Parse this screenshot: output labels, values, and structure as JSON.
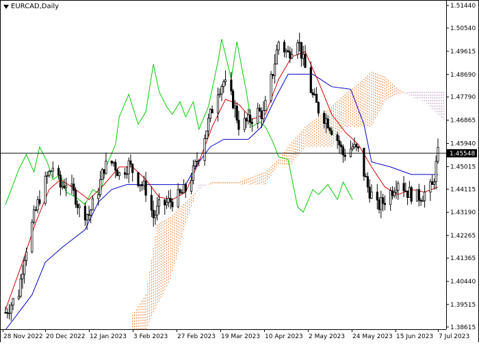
{
  "header": {
    "symbol_label": "EURCAD,Daily"
  },
  "colors": {
    "candle": "#000000",
    "tenkan": "#d40000",
    "kijun": "#0000c8",
    "chikou": "#00cc00",
    "cloud_up": "#f08030",
    "cloud_down": "#c8a0c8",
    "price_line": "#000000",
    "price_box_bg": "#000000",
    "price_box_text": "#ffffff"
  },
  "chart_data": {
    "type": "candlestick",
    "title": "EURCAD,Daily",
    "indicator": "Ichimoku Kinko Hyo",
    "y_axis_ticks": [
      "1.51440",
      "1.50540",
      "1.49615",
      "1.48690",
      "1.47790",
      "1.46865",
      "1.45940",
      "1.45015",
      "1.44115",
      "1.43190",
      "1.42265",
      "1.41365",
      "1.40440",
      "1.39515",
      "1.38615"
    ],
    "ylim": [
      1.3861,
      1.5155
    ],
    "x_axis_ticks": [
      "28 Nov 2022",
      "20 Dec 2022",
      "12 Jan 2023",
      "3 Feb 2023",
      "27 Feb 2023",
      "19 Mar 2023",
      "10 Apr 2023",
      "2 May 2023",
      "24 May 2023",
      "15 Jun 2023",
      "7 Jul 2023"
    ],
    "current_price": "1.45548",
    "current_price_value": 1.45548,
    "date_range": [
      "2022-11-21",
      "2023-07-07"
    ],
    "close_path": [
      [
        "2022-11-21",
        1.392
      ],
      [
        "2022-11-28",
        1.4
      ],
      [
        "2022-12-01",
        1.415
      ],
      [
        "2022-12-06",
        1.43
      ],
      [
        "2022-12-09",
        1.438
      ],
      [
        "2022-12-13",
        1.446
      ],
      [
        "2022-12-16",
        1.45
      ],
      [
        "2022-12-20",
        1.442
      ],
      [
        "2022-12-23",
        1.444
      ],
      [
        "2022-12-28",
        1.438
      ],
      [
        "2022-12-30",
        1.433
      ],
      [
        "2023-01-04",
        1.431
      ],
      [
        "2023-01-09",
        1.441
      ],
      [
        "2023-01-12",
        1.45
      ],
      [
        "2023-01-17",
        1.452
      ],
      [
        "2023-01-20",
        1.447
      ],
      [
        "2023-01-25",
        1.451
      ],
      [
        "2023-01-30",
        1.445
      ],
      [
        "2023-02-03",
        1.441
      ],
      [
        "2023-02-07",
        1.43
      ],
      [
        "2023-02-10",
        1.434
      ],
      [
        "2023-02-15",
        1.436
      ],
      [
        "2023-02-20",
        1.438
      ],
      [
        "2023-02-24",
        1.441
      ],
      [
        "2023-02-28",
        1.448
      ],
      [
        "2023-03-03",
        1.455
      ],
      [
        "2023-03-08",
        1.468
      ],
      [
        "2023-03-13",
        1.481
      ],
      [
        "2023-03-16",
        1.484
      ],
      [
        "2023-03-21",
        1.476
      ],
      [
        "2023-03-24",
        1.467
      ],
      [
        "2023-03-29",
        1.468
      ],
      [
        "2023-04-03",
        1.472
      ],
      [
        "2023-04-06",
        1.471
      ],
      [
        "2023-04-11",
        1.488
      ],
      [
        "2023-04-14",
        1.5
      ],
      [
        "2023-04-19",
        1.495
      ],
      [
        "2023-04-24",
        1.502
      ],
      [
        "2023-04-27",
        1.492
      ],
      [
        "2023-05-02",
        1.478
      ],
      [
        "2023-05-05",
        1.473
      ],
      [
        "2023-05-10",
        1.468
      ],
      [
        "2023-05-15",
        1.461
      ],
      [
        "2023-05-18",
        1.455
      ],
      [
        "2023-05-23",
        1.458
      ],
      [
        "2023-05-26",
        1.456
      ],
      [
        "2023-05-31",
        1.442
      ],
      [
        "2023-06-05",
        1.434
      ],
      [
        "2023-06-08",
        1.436
      ],
      [
        "2023-06-13",
        1.441
      ],
      [
        "2023-06-16",
        1.445
      ],
      [
        "2023-06-21",
        1.44
      ],
      [
        "2023-06-26",
        1.438
      ],
      [
        "2023-06-29",
        1.439
      ],
      [
        "2023-07-04",
        1.442
      ],
      [
        "2023-07-07",
        1.455
      ]
    ],
    "tenkan_sen": [
      [
        "2022-11-21",
        1.393
      ],
      [
        "2022-11-30",
        1.412
      ],
      [
        "2022-12-07",
        1.428
      ],
      [
        "2022-12-14",
        1.441
      ],
      [
        "2022-12-20",
        1.445
      ],
      [
        "2022-12-28",
        1.441
      ],
      [
        "2023-01-04",
        1.437
      ],
      [
        "2023-01-12",
        1.443
      ],
      [
        "2023-01-20",
        1.45
      ],
      [
        "2023-01-27",
        1.45
      ],
      [
        "2023-02-03",
        1.445
      ],
      [
        "2023-02-10",
        1.438
      ],
      [
        "2023-02-17",
        1.437
      ],
      [
        "2023-02-24",
        1.44
      ],
      [
        "2023-03-03",
        1.452
      ],
      [
        "2023-03-10",
        1.466
      ],
      [
        "2023-03-17",
        1.477
      ],
      [
        "2023-03-24",
        1.475
      ],
      [
        "2023-03-31",
        1.469
      ],
      [
        "2023-04-07",
        1.471
      ],
      [
        "2023-04-14",
        1.485
      ],
      [
        "2023-04-21",
        1.494
      ],
      [
        "2023-04-28",
        1.496
      ],
      [
        "2023-05-05",
        1.484
      ],
      [
        "2023-05-12",
        1.471
      ],
      [
        "2023-05-19",
        1.464
      ],
      [
        "2023-05-26",
        1.459
      ],
      [
        "2023-06-02",
        1.45
      ],
      [
        "2023-06-09",
        1.442
      ],
      [
        "2023-06-16",
        1.439
      ],
      [
        "2023-06-23",
        1.441
      ],
      [
        "2023-06-30",
        1.44
      ],
      [
        "2023-07-07",
        1.442
      ]
    ],
    "kijun_sen": [
      [
        "2022-11-21",
        1.385
      ],
      [
        "2022-12-05",
        1.399
      ],
      [
        "2022-12-12",
        1.412
      ],
      [
        "2022-12-21",
        1.418
      ],
      [
        "2023-01-02",
        1.425
      ],
      [
        "2023-01-09",
        1.436
      ],
      [
        "2023-01-16",
        1.441
      ],
      [
        "2023-01-24",
        1.443
      ],
      [
        "2023-02-02",
        1.443
      ],
      [
        "2023-02-14",
        1.443
      ],
      [
        "2023-02-24",
        1.443
      ],
      [
        "2023-03-02",
        1.451
      ],
      [
        "2023-03-09",
        1.458
      ],
      [
        "2023-03-16",
        1.461
      ],
      [
        "2023-03-29",
        1.461
      ],
      [
        "2023-04-05",
        1.466
      ],
      [
        "2023-04-12",
        1.477
      ],
      [
        "2023-04-19",
        1.487
      ],
      [
        "2023-05-02",
        1.487
      ],
      [
        "2023-05-12",
        1.482
      ],
      [
        "2023-05-22",
        1.481
      ],
      [
        "2023-05-29",
        1.467
      ],
      [
        "2023-06-02",
        1.452
      ],
      [
        "2023-06-12",
        1.45
      ],
      [
        "2023-06-23",
        1.447
      ],
      [
        "2023-07-07",
        1.447
      ]
    ],
    "chikou_span": [
      [
        "2022-11-21",
        1.435
      ],
      [
        "2022-11-28",
        1.449
      ],
      [
        "2022-12-02",
        1.455
      ],
      [
        "2022-12-06",
        1.448
      ],
      [
        "2022-12-09",
        1.458
      ],
      [
        "2022-12-13",
        1.452
      ],
      [
        "2022-12-16",
        1.445
      ],
      [
        "2022-12-20",
        1.447
      ],
      [
        "2022-12-23",
        1.44
      ],
      [
        "2022-12-28",
        1.438
      ],
      [
        "2023-01-02",
        1.435
      ],
      [
        "2023-01-06",
        1.441
      ],
      [
        "2023-01-10",
        1.439
      ],
      [
        "2023-01-13",
        1.45
      ],
      [
        "2023-01-18",
        1.459
      ],
      [
        "2023-01-20",
        1.47
      ],
      [
        "2023-01-25",
        1.479
      ],
      [
        "2023-01-30",
        1.467
      ],
      [
        "2023-02-03",
        1.472
      ],
      [
        "2023-02-07",
        1.491
      ],
      [
        "2023-02-10",
        1.48
      ],
      [
        "2023-02-14",
        1.474
      ],
      [
        "2023-02-17",
        1.471
      ],
      [
        "2023-02-21",
        1.476
      ],
      [
        "2023-02-24",
        1.47
      ],
      [
        "2023-02-28",
        1.476
      ],
      [
        "2023-03-03",
        1.465
      ],
      [
        "2023-03-08",
        1.474
      ],
      [
        "2023-03-13",
        1.492
      ],
      [
        "2023-03-15",
        1.501
      ],
      [
        "2023-03-20",
        1.485
      ],
      [
        "2023-03-23",
        1.5
      ],
      [
        "2023-03-28",
        1.48
      ],
      [
        "2023-03-31",
        1.466
      ],
      [
        "2023-04-04",
        1.468
      ],
      [
        "2023-04-07",
        1.466
      ],
      [
        "2023-04-11",
        1.46
      ],
      [
        "2023-04-14",
        1.454
      ],
      [
        "2023-04-19",
        1.453
      ],
      [
        "2023-04-24",
        1.434
      ],
      [
        "2023-04-27",
        1.432
      ],
      [
        "2023-05-02",
        1.441
      ],
      [
        "2023-05-05",
        1.439
      ],
      [
        "2023-05-10",
        1.443
      ],
      [
        "2023-05-15",
        1.437
      ],
      [
        "2023-05-18",
        1.444
      ],
      [
        "2023-05-23",
        1.437
      ]
    ],
    "senkou_span_a": [
      [
        "2023-01-27",
        1.391
      ],
      [
        "2023-02-03",
        1.399
      ],
      [
        "2023-02-09",
        1.427
      ],
      [
        "2023-02-16",
        1.43
      ],
      [
        "2023-02-24",
        1.436
      ],
      [
        "2023-03-03",
        1.441
      ],
      [
        "2023-03-10",
        1.444
      ],
      [
        "2023-03-17",
        1.444
      ],
      [
        "2023-03-24",
        1.444
      ],
      [
        "2023-03-31",
        1.446
      ],
      [
        "2023-04-07",
        1.448
      ],
      [
        "2023-04-14",
        1.453
      ],
      [
        "2023-04-21",
        1.46
      ],
      [
        "2023-04-28",
        1.466
      ],
      [
        "2023-05-05",
        1.47
      ],
      [
        "2023-05-12",
        1.474
      ],
      [
        "2023-05-19",
        1.479
      ],
      [
        "2023-05-26",
        1.483
      ],
      [
        "2023-06-02",
        1.488
      ],
      [
        "2023-06-09",
        1.486
      ],
      [
        "2023-06-16",
        1.481
      ],
      [
        "2023-06-23",
        1.478
      ],
      [
        "2023-06-30",
        1.476
      ],
      [
        "2023-07-07",
        1.471
      ],
      [
        "2023-07-14",
        1.466
      ]
    ],
    "senkou_span_b": [
      [
        "2023-01-27",
        1.385
      ],
      [
        "2023-02-03",
        1.385
      ],
      [
        "2023-02-09",
        1.395
      ],
      [
        "2023-02-16",
        1.405
      ],
      [
        "2023-02-24",
        1.427
      ],
      [
        "2023-03-03",
        1.443
      ],
      [
        "2023-03-10",
        1.443
      ],
      [
        "2023-03-17",
        1.443
      ],
      [
        "2023-03-24",
        1.443
      ],
      [
        "2023-03-31",
        1.443
      ],
      [
        "2023-04-07",
        1.443
      ],
      [
        "2023-04-14",
        1.451
      ],
      [
        "2023-04-21",
        1.451
      ],
      [
        "2023-04-28",
        1.458
      ],
      [
        "2023-05-05",
        1.458
      ],
      [
        "2023-05-12",
        1.458
      ],
      [
        "2023-05-19",
        1.466
      ],
      [
        "2023-05-26",
        1.466
      ],
      [
        "2023-06-02",
        1.466
      ],
      [
        "2023-06-09",
        1.476
      ],
      [
        "2023-06-16",
        1.479
      ],
      [
        "2023-06-23",
        1.48
      ],
      [
        "2023-06-30",
        1.48
      ],
      [
        "2023-07-07",
        1.48
      ],
      [
        "2023-07-14",
        1.48
      ]
    ],
    "grid": false,
    "legend": "none"
  }
}
